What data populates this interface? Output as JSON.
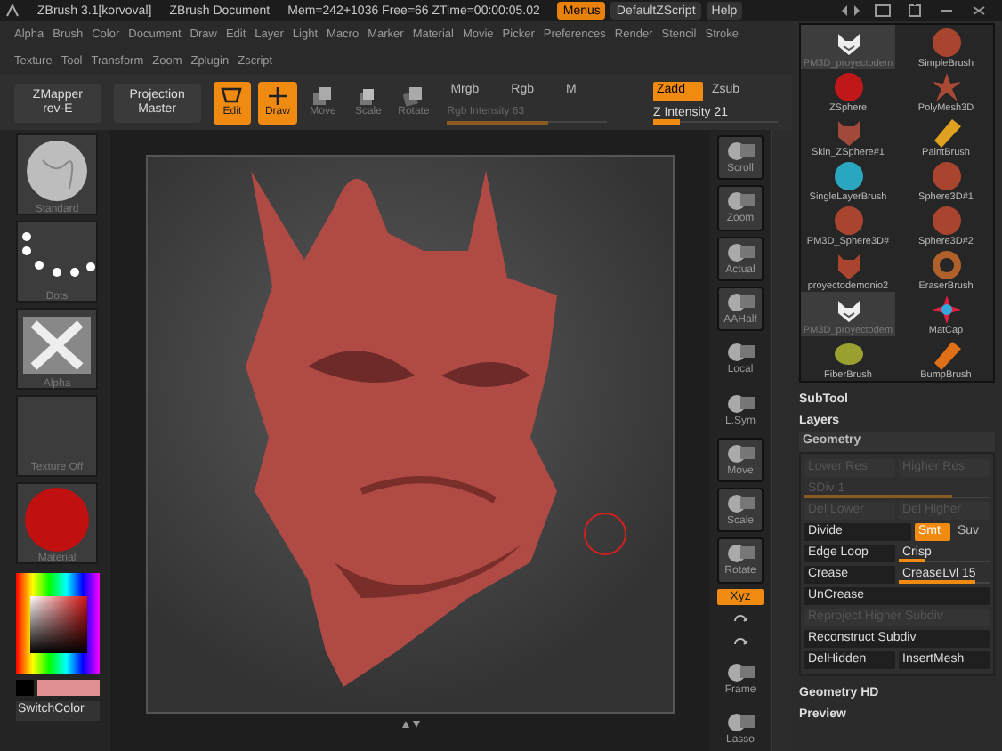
{
  "title_bar": {
    "app": "ZBrush 3.1[korvoval]",
    "document": "ZBrush Document",
    "stats": "Mem=242+1036 Free=66 ZTime=00:00:05.02",
    "buttons": [
      {
        "label": "Menus",
        "selected": true
      },
      {
        "label": "DefaultZScript",
        "selected": false
      },
      {
        "label": "Help",
        "selected": false
      }
    ]
  },
  "menus": [
    [
      "Alpha",
      "Brush",
      "Color",
      "Document",
      "Draw",
      "Edit",
      "Layer",
      "Light",
      "Macro",
      "Marker",
      "Material",
      "Movie",
      "Picker",
      "Preferences",
      "Render",
      "Stencil",
      "Stroke"
    ],
    [
      "Texture",
      "Tool",
      "Transform",
      "Zoom",
      "Zplugin",
      "Zscript"
    ]
  ],
  "toolbar": {
    "plugins": [
      {
        "line1": "ZMapper",
        "line2": "rev-E"
      },
      {
        "line1": "Projection",
        "line2": "Master"
      }
    ],
    "modes": [
      {
        "label": "Edit",
        "on": true
      },
      {
        "label": "Draw",
        "on": true
      },
      {
        "label": "Move",
        "on": false
      },
      {
        "label": "Scale",
        "on": false
      },
      {
        "label": "Rotate",
        "on": false
      }
    ],
    "color_modes": [
      {
        "label": "Mrgb",
        "selected": false
      },
      {
        "label": "Rgb",
        "selected": false
      },
      {
        "label": "M",
        "selected": false
      }
    ],
    "rgb_intensity": {
      "label": "Rgb Intensity 63",
      "level": 0.63
    },
    "depth_modes": [
      {
        "label": "Zadd",
        "selected": true
      },
      {
        "label": "Zsub",
        "selected": false
      }
    ],
    "z_intensity": {
      "label": "Z Intensity 21",
      "level": 0.21
    }
  },
  "left_shelf": {
    "items": [
      {
        "kind": "brush",
        "label": "Standard"
      },
      {
        "kind": "stroke",
        "label": "Dots"
      },
      {
        "kind": "alpha",
        "label": "Alpha"
      },
      {
        "kind": "texture",
        "label": "Texture Off"
      },
      {
        "kind": "material",
        "label": "Material"
      }
    ],
    "color_button": "SwitchColor"
  },
  "right_shelf": [
    {
      "kind": "boxed",
      "label": "Scroll",
      "on": false
    },
    {
      "kind": "boxed",
      "label": "Zoom",
      "on": false
    },
    {
      "kind": "boxed",
      "label": "Actual",
      "on": false
    },
    {
      "kind": "boxed",
      "label": "AAHalf",
      "on": false
    },
    {
      "kind": "plain",
      "label": "Local",
      "on": false
    },
    {
      "kind": "plain",
      "label": "L.Sym",
      "on": false
    },
    {
      "kind": "boxed",
      "label": "Move",
      "on": false
    },
    {
      "kind": "boxed",
      "label": "Scale",
      "on": false
    },
    {
      "kind": "boxed",
      "label": "Rotate",
      "on": false
    },
    {
      "kind": "toggle",
      "label": "Xyz",
      "on": true
    },
    {
      "kind": "icon"
    },
    {
      "kind": "icon"
    },
    {
      "kind": "plain",
      "label": "Frame",
      "on": false
    },
    {
      "kind": "plain",
      "label": "Lasso",
      "on": false
    }
  ],
  "tool_palette": {
    "tools": [
      {
        "kind": "mask",
        "label": "PM3D_proyectodem",
        "selected": true,
        "color": "#eeeeee"
      },
      {
        "kind": "sphere",
        "label": "SimpleBrush",
        "selected": false,
        "color": "#a9452f"
      },
      {
        "kind": "sphere",
        "label": "ZSphere",
        "selected": false,
        "color": "#c01818"
      },
      {
        "kind": "star",
        "label": "PolyMesh3D",
        "selected": false,
        "color": "#a94a36"
      },
      {
        "kind": "head",
        "label": "Skin_ZSphere#1",
        "selected": false,
        "color": "#a14a3c"
      },
      {
        "kind": "brush",
        "label": "PaintBrush",
        "selected": false,
        "color": "#e0a020"
      },
      {
        "kind": "sphere",
        "label": "SingleLayerBrush",
        "selected": false,
        "color": "#2aa6c0"
      },
      {
        "kind": "sphere",
        "label": "Sphere3D#1",
        "selected": false,
        "color": "#a9452f"
      },
      {
        "kind": "sphere",
        "label": "PM3D_Sphere3D#",
        "selected": false,
        "color": "#a9452f"
      },
      {
        "kind": "sphere",
        "label": "Sphere3D#2",
        "selected": false,
        "color": "#a9452f"
      },
      {
        "kind": "head",
        "label": "proyectodemonio2",
        "selected": false,
        "color": "#a9452f"
      },
      {
        "kind": "ring",
        "label": "EraserBrush",
        "selected": false,
        "color": "#b0602a"
      },
      {
        "kind": "mask",
        "label": "PM3D_proyectodem",
        "selected": true,
        "color": "#eeeeee"
      },
      {
        "kind": "burst",
        "label": "MatCap",
        "selected": false,
        "color": "#e02040"
      },
      {
        "kind": "blob",
        "label": "FiberBrush",
        "selected": false,
        "color": "#9aa030"
      },
      {
        "kind": "brush",
        "label": "BumpBrush",
        "selected": false,
        "color": "#e07018"
      }
    ],
    "sections_before": [
      "SubTool",
      "Layers"
    ],
    "geometry": {
      "title": "Geometry",
      "rows": [
        [
          {
            "kind": "button",
            "label": "Lower Res",
            "disabled": true
          },
          {
            "kind": "button",
            "label": "Higher Res",
            "disabled": true
          }
        ],
        [
          {
            "kind": "slider",
            "label": "SDiv 1",
            "level": 0.8,
            "disabled": true
          }
        ],
        [
          {
            "kind": "button",
            "label": "Del Lower",
            "disabled": true
          },
          {
            "kind": "button",
            "label": "Del Higher",
            "disabled": true
          }
        ],
        [
          {
            "kind": "button",
            "label": "Divide",
            "disabled": false
          },
          {
            "kind": "toggle",
            "label": "Smt",
            "on": true
          },
          {
            "kind": "toggle",
            "label": "Suv",
            "on": false
          }
        ],
        [
          {
            "kind": "button",
            "label": "Edge Loop",
            "disabled": false
          },
          {
            "kind": "slider",
            "label": "Crisp",
            "level": 0.3,
            "disabled": false
          }
        ],
        [
          {
            "kind": "button",
            "label": "Crease",
            "disabled": false
          },
          {
            "kind": "slider",
            "label": "CreaseLvl 15",
            "level": 0.85,
            "disabled": false
          }
        ],
        [
          {
            "kind": "button",
            "label": "UnCrease",
            "disabled": false
          }
        ],
        [
          {
            "kind": "button",
            "label": "Reproject Higher Subdiv",
            "disabled": true
          }
        ],
        [
          {
            "kind": "button",
            "label": "Reconstruct Subdiv",
            "disabled": false
          }
        ],
        [
          {
            "kind": "button",
            "label": "DelHidden",
            "disabled": false
          },
          {
            "kind": "button",
            "label": "InsertMesh",
            "disabled": false
          }
        ]
      ]
    },
    "sections_after": [
      "Geometry HD",
      "Preview"
    ]
  }
}
